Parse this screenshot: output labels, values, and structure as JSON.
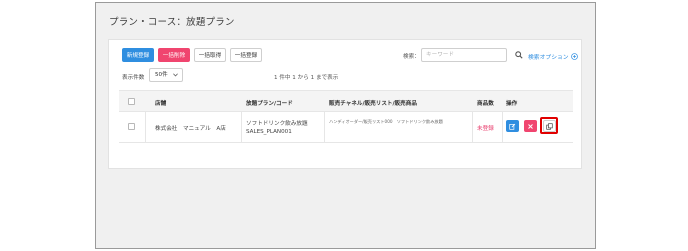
{
  "page": {
    "title": "プラン・コース：放題プラン"
  },
  "toolbar": {
    "new_label": "新規登録",
    "bulk_delete_label": "一括削除",
    "bulk_get_label": "一括取得",
    "bulk_register_label": "一括登録",
    "search_label": "検索：",
    "search_placeholder": "キーワード",
    "search_value": "",
    "search_options_label": "検索オプション"
  },
  "pagination": {
    "per_page_label": "表示件数",
    "per_page_value": "50件",
    "count_text": "1 件中 1 から 1 まで表示"
  },
  "table": {
    "headers": {
      "store": "店舗",
      "plan": "放題プラン/コード",
      "channel": "販売チャネル/販売リスト/販売商品",
      "product_count": "商品数",
      "actions": "操作"
    },
    "rows": [
      {
        "store": "株式会社　マニュアル　A店",
        "plan_name": "ソフトドリンク飲み放題",
        "plan_code": "SALES_PLAN001",
        "channel": "ハンディオーダー/販売リスト000　ソフトドリンク飲み放題",
        "product_count": "未登録"
      }
    ]
  },
  "icons": {
    "search": "search-icon",
    "options": "plus-circle-icon",
    "edit": "edit-icon",
    "delete": "close-icon",
    "copy": "copy-icon"
  },
  "colors": {
    "primary": "#2f8ee0",
    "danger": "#f0456f",
    "highlight": "#e00000",
    "unregistered": "#e8396a"
  }
}
